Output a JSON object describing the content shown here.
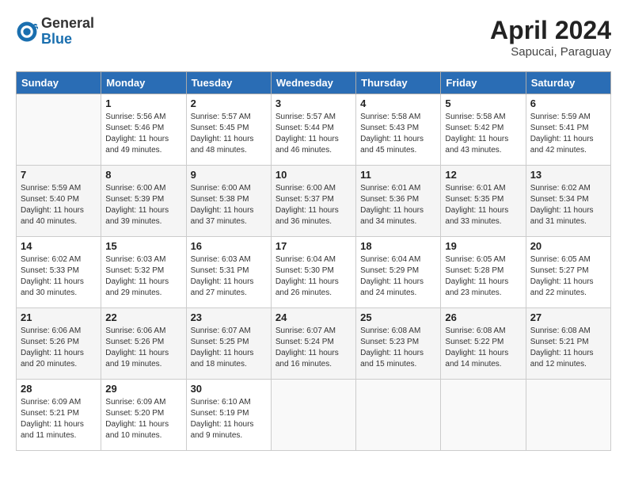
{
  "header": {
    "logo_general": "General",
    "logo_blue": "Blue",
    "month": "April 2024",
    "location": "Sapucai, Paraguay"
  },
  "days_of_week": [
    "Sunday",
    "Monday",
    "Tuesday",
    "Wednesday",
    "Thursday",
    "Friday",
    "Saturday"
  ],
  "weeks": [
    [
      {
        "day": "",
        "info": ""
      },
      {
        "day": "1",
        "info": "Sunrise: 5:56 AM\nSunset: 5:46 PM\nDaylight: 11 hours\nand 49 minutes."
      },
      {
        "day": "2",
        "info": "Sunrise: 5:57 AM\nSunset: 5:45 PM\nDaylight: 11 hours\nand 48 minutes."
      },
      {
        "day": "3",
        "info": "Sunrise: 5:57 AM\nSunset: 5:44 PM\nDaylight: 11 hours\nand 46 minutes."
      },
      {
        "day": "4",
        "info": "Sunrise: 5:58 AM\nSunset: 5:43 PM\nDaylight: 11 hours\nand 45 minutes."
      },
      {
        "day": "5",
        "info": "Sunrise: 5:58 AM\nSunset: 5:42 PM\nDaylight: 11 hours\nand 43 minutes."
      },
      {
        "day": "6",
        "info": "Sunrise: 5:59 AM\nSunset: 5:41 PM\nDaylight: 11 hours\nand 42 minutes."
      }
    ],
    [
      {
        "day": "7",
        "info": "Sunrise: 5:59 AM\nSunset: 5:40 PM\nDaylight: 11 hours\nand 40 minutes."
      },
      {
        "day": "8",
        "info": "Sunrise: 6:00 AM\nSunset: 5:39 PM\nDaylight: 11 hours\nand 39 minutes."
      },
      {
        "day": "9",
        "info": "Sunrise: 6:00 AM\nSunset: 5:38 PM\nDaylight: 11 hours\nand 37 minutes."
      },
      {
        "day": "10",
        "info": "Sunrise: 6:00 AM\nSunset: 5:37 PM\nDaylight: 11 hours\nand 36 minutes."
      },
      {
        "day": "11",
        "info": "Sunrise: 6:01 AM\nSunset: 5:36 PM\nDaylight: 11 hours\nand 34 minutes."
      },
      {
        "day": "12",
        "info": "Sunrise: 6:01 AM\nSunset: 5:35 PM\nDaylight: 11 hours\nand 33 minutes."
      },
      {
        "day": "13",
        "info": "Sunrise: 6:02 AM\nSunset: 5:34 PM\nDaylight: 11 hours\nand 31 minutes."
      }
    ],
    [
      {
        "day": "14",
        "info": "Sunrise: 6:02 AM\nSunset: 5:33 PM\nDaylight: 11 hours\nand 30 minutes."
      },
      {
        "day": "15",
        "info": "Sunrise: 6:03 AM\nSunset: 5:32 PM\nDaylight: 11 hours\nand 29 minutes."
      },
      {
        "day": "16",
        "info": "Sunrise: 6:03 AM\nSunset: 5:31 PM\nDaylight: 11 hours\nand 27 minutes."
      },
      {
        "day": "17",
        "info": "Sunrise: 6:04 AM\nSunset: 5:30 PM\nDaylight: 11 hours\nand 26 minutes."
      },
      {
        "day": "18",
        "info": "Sunrise: 6:04 AM\nSunset: 5:29 PM\nDaylight: 11 hours\nand 24 minutes."
      },
      {
        "day": "19",
        "info": "Sunrise: 6:05 AM\nSunset: 5:28 PM\nDaylight: 11 hours\nand 23 minutes."
      },
      {
        "day": "20",
        "info": "Sunrise: 6:05 AM\nSunset: 5:27 PM\nDaylight: 11 hours\nand 22 minutes."
      }
    ],
    [
      {
        "day": "21",
        "info": "Sunrise: 6:06 AM\nSunset: 5:26 PM\nDaylight: 11 hours\nand 20 minutes."
      },
      {
        "day": "22",
        "info": "Sunrise: 6:06 AM\nSunset: 5:26 PM\nDaylight: 11 hours\nand 19 minutes."
      },
      {
        "day": "23",
        "info": "Sunrise: 6:07 AM\nSunset: 5:25 PM\nDaylight: 11 hours\nand 18 minutes."
      },
      {
        "day": "24",
        "info": "Sunrise: 6:07 AM\nSunset: 5:24 PM\nDaylight: 11 hours\nand 16 minutes."
      },
      {
        "day": "25",
        "info": "Sunrise: 6:08 AM\nSunset: 5:23 PM\nDaylight: 11 hours\nand 15 minutes."
      },
      {
        "day": "26",
        "info": "Sunrise: 6:08 AM\nSunset: 5:22 PM\nDaylight: 11 hours\nand 14 minutes."
      },
      {
        "day": "27",
        "info": "Sunrise: 6:08 AM\nSunset: 5:21 PM\nDaylight: 11 hours\nand 12 minutes."
      }
    ],
    [
      {
        "day": "28",
        "info": "Sunrise: 6:09 AM\nSunset: 5:21 PM\nDaylight: 11 hours\nand 11 minutes."
      },
      {
        "day": "29",
        "info": "Sunrise: 6:09 AM\nSunset: 5:20 PM\nDaylight: 11 hours\nand 10 minutes."
      },
      {
        "day": "30",
        "info": "Sunrise: 6:10 AM\nSunset: 5:19 PM\nDaylight: 11 hours\nand 9 minutes."
      },
      {
        "day": "",
        "info": ""
      },
      {
        "day": "",
        "info": ""
      },
      {
        "day": "",
        "info": ""
      },
      {
        "day": "",
        "info": ""
      }
    ]
  ]
}
